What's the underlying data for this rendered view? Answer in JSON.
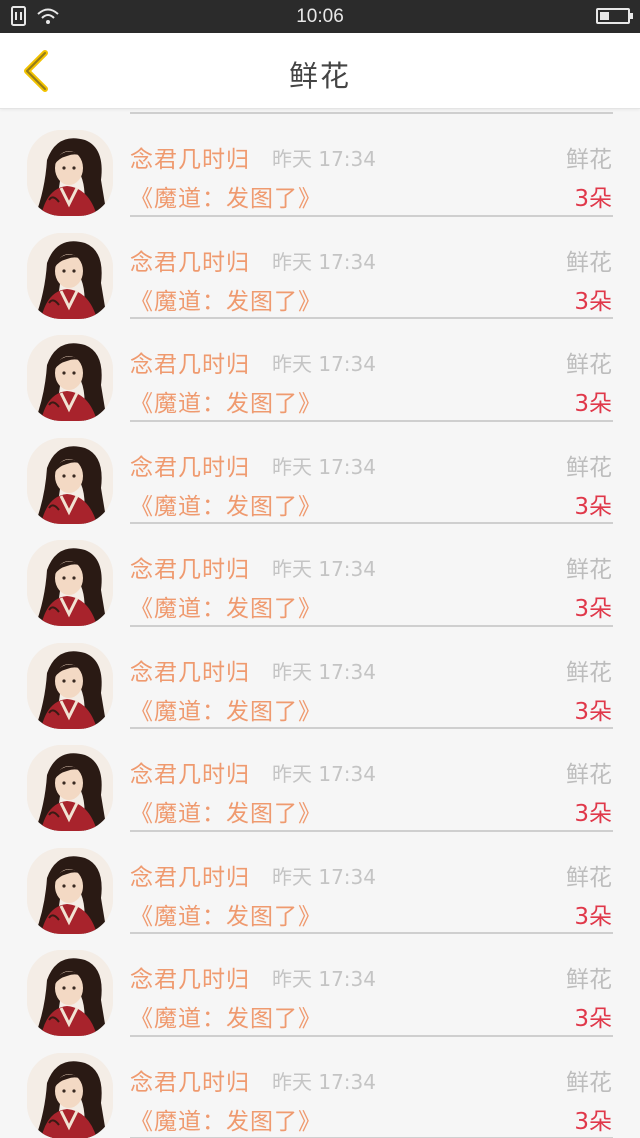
{
  "status_bar": {
    "time": "10:06",
    "battery_level": 0.35
  },
  "header": {
    "title": "鲜花"
  },
  "colors": {
    "accent_orange": "#ef9a6f",
    "count_red": "#e0384a",
    "back_arrow": "#f2c200"
  },
  "gifts": [
    {
      "user": "念君几时归",
      "time": "昨天 17:34",
      "type": "鲜花",
      "work": "《魔道：发图了》",
      "count": "3朵"
    },
    {
      "user": "念君几时归",
      "time": "昨天 17:34",
      "type": "鲜花",
      "work": "《魔道：发图了》",
      "count": "3朵"
    },
    {
      "user": "念君几时归",
      "time": "昨天 17:34",
      "type": "鲜花",
      "work": "《魔道：发图了》",
      "count": "3朵"
    },
    {
      "user": "念君几时归",
      "time": "昨天 17:34",
      "type": "鲜花",
      "work": "《魔道：发图了》",
      "count": "3朵"
    },
    {
      "user": "念君几时归",
      "time": "昨天 17:34",
      "type": "鲜花",
      "work": "《魔道：发图了》",
      "count": "3朵"
    },
    {
      "user": "念君几时归",
      "time": "昨天 17:34",
      "type": "鲜花",
      "work": "《魔道：发图了》",
      "count": "3朵"
    },
    {
      "user": "念君几时归",
      "time": "昨天 17:34",
      "type": "鲜花",
      "work": "《魔道：发图了》",
      "count": "3朵"
    },
    {
      "user": "念君几时归",
      "time": "昨天 17:34",
      "type": "鲜花",
      "work": "《魔道：发图了》",
      "count": "3朵"
    },
    {
      "user": "念君几时归",
      "time": "昨天 17:34",
      "type": "鲜花",
      "work": "《魔道：发图了》",
      "count": "3朵"
    },
    {
      "user": "念君几时归",
      "time": "昨天 17:34",
      "type": "鲜花",
      "work": "《魔道：发图了》",
      "count": "3朵"
    }
  ]
}
